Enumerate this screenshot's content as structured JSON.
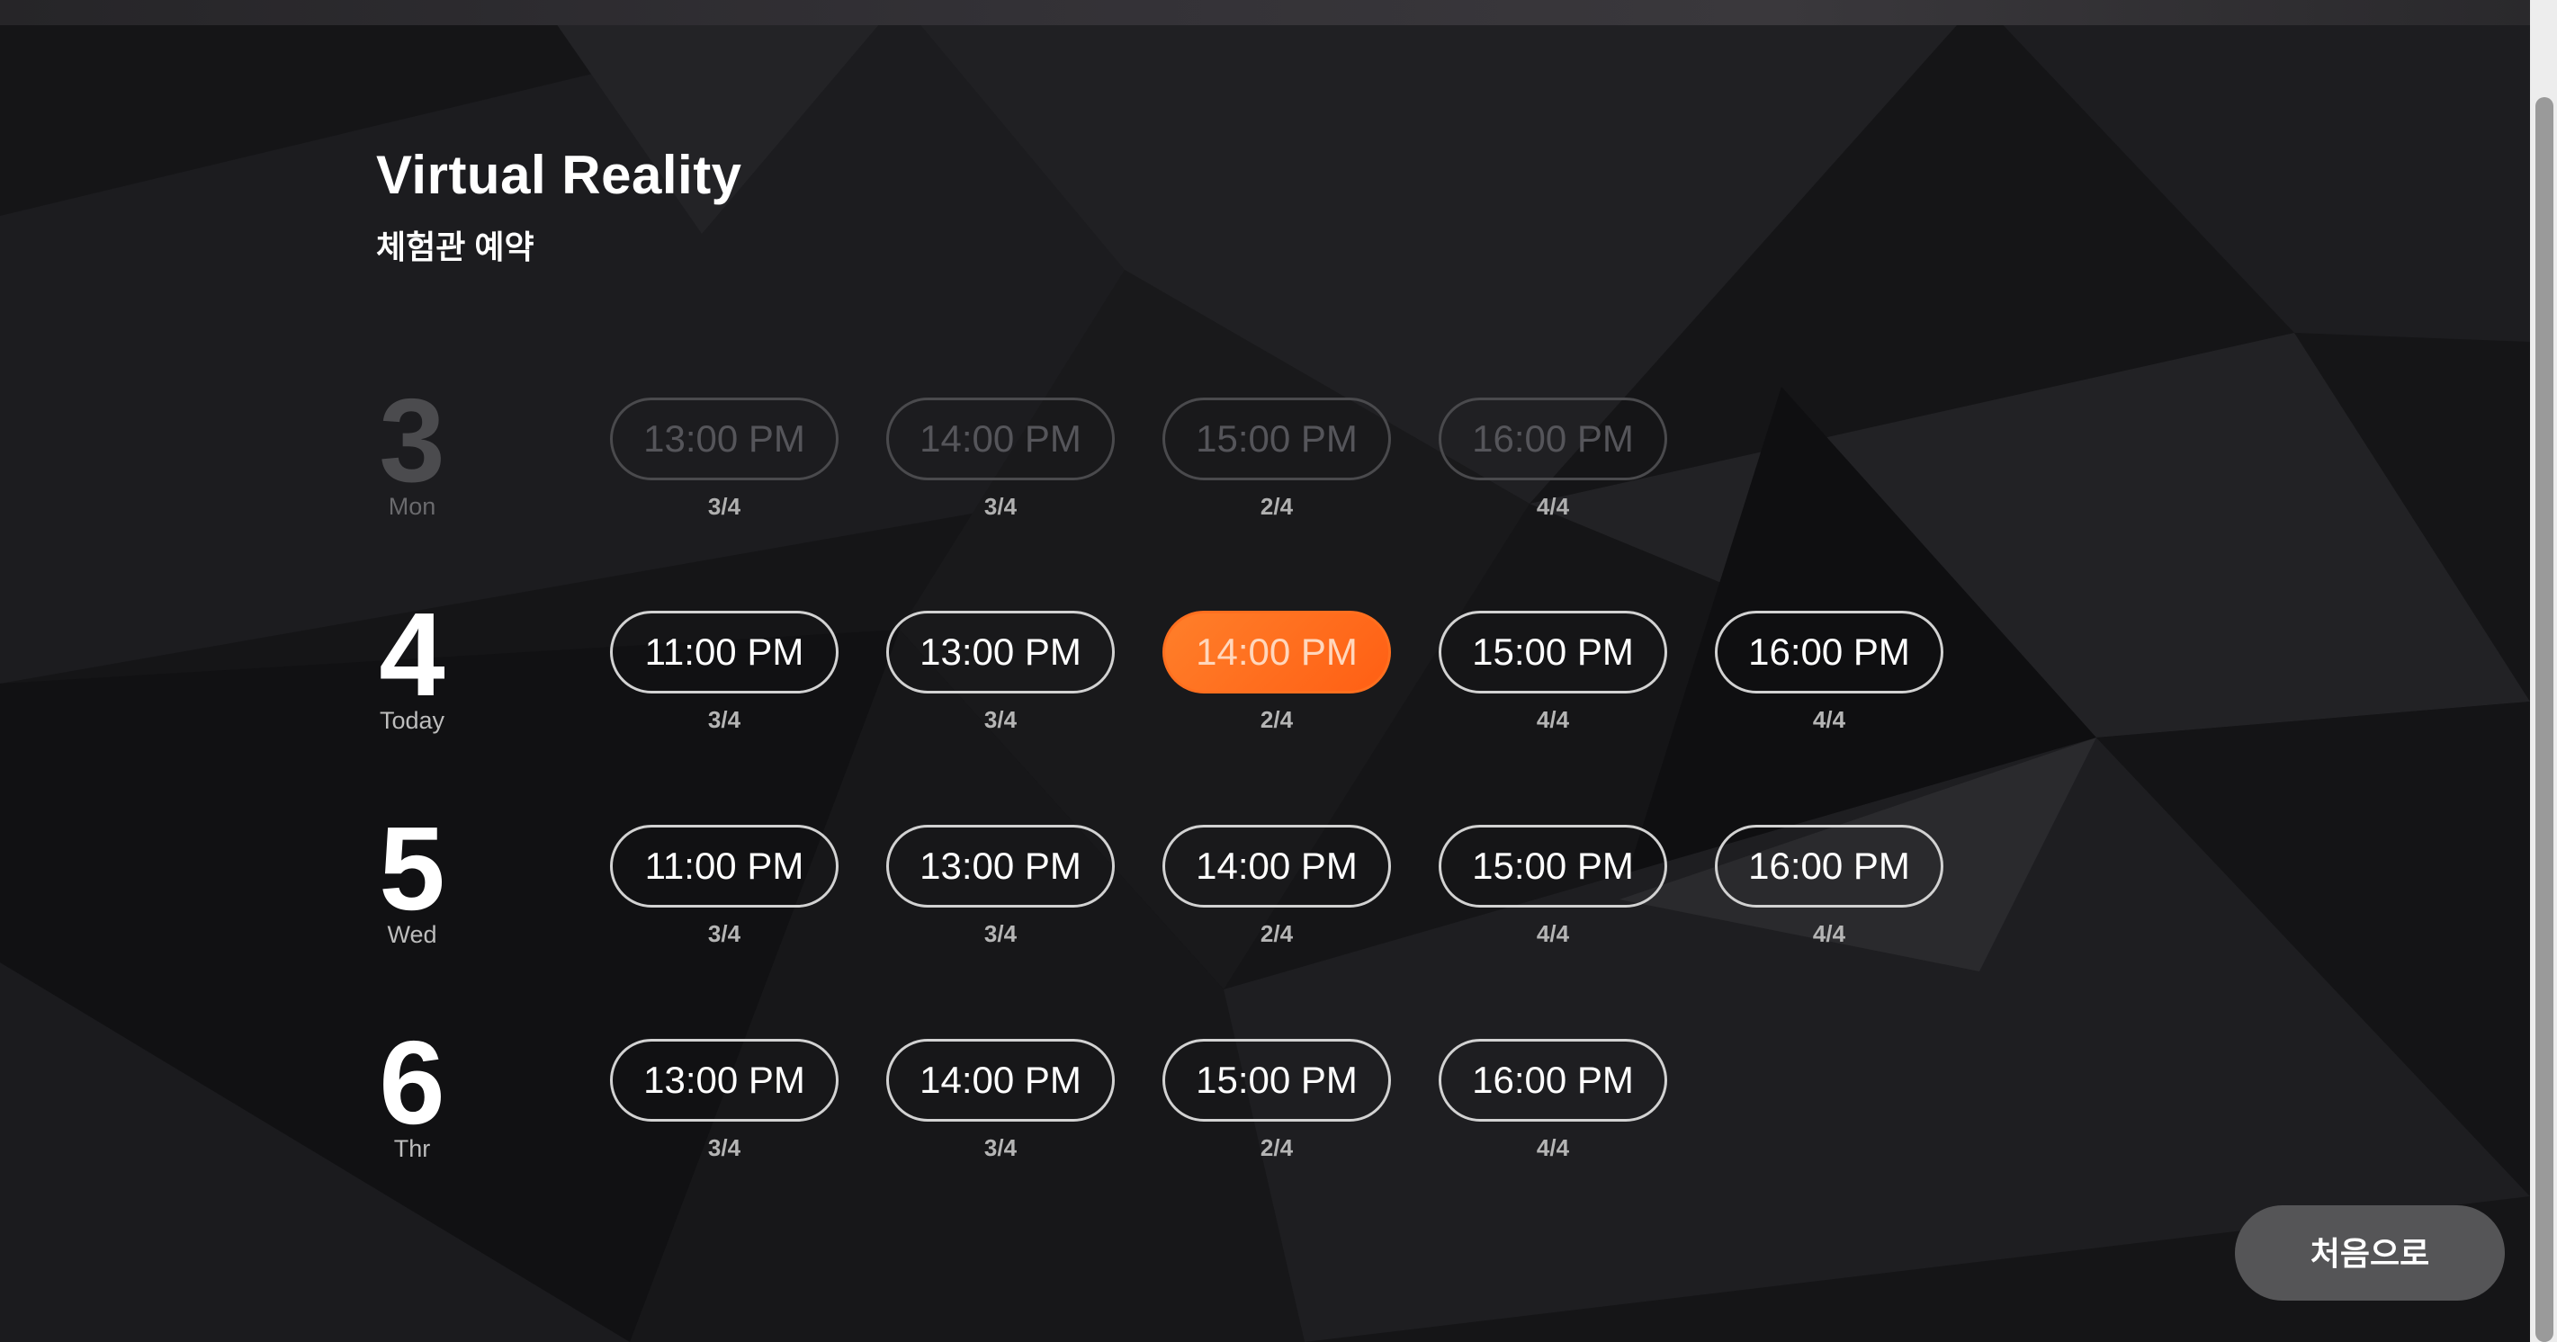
{
  "header": {
    "title": "Virtual Reality",
    "subtitle": "체험관 예약"
  },
  "schedule": [
    {
      "date": "3",
      "day": "Mon",
      "disabled": true,
      "slots": [
        {
          "time": "13:00 PM",
          "capacity": "3/4"
        },
        {
          "time": "14:00 PM",
          "capacity": "3/4"
        },
        {
          "time": "15:00 PM",
          "capacity": "2/4"
        },
        {
          "time": "16:00 PM",
          "capacity": "4/4"
        }
      ]
    },
    {
      "date": "4",
      "day": "Today",
      "disabled": false,
      "slots": [
        {
          "time": "11:00 PM",
          "capacity": "3/4"
        },
        {
          "time": "13:00 PM",
          "capacity": "3/4"
        },
        {
          "time": "14:00 PM",
          "capacity": "2/4",
          "selected": true
        },
        {
          "time": "15:00 PM",
          "capacity": "4/4"
        },
        {
          "time": "16:00 PM",
          "capacity": "4/4"
        }
      ]
    },
    {
      "date": "5",
      "day": "Wed",
      "disabled": false,
      "slots": [
        {
          "time": "11:00 PM",
          "capacity": "3/4"
        },
        {
          "time": "13:00 PM",
          "capacity": "3/4"
        },
        {
          "time": "14:00 PM",
          "capacity": "2/4"
        },
        {
          "time": "15:00 PM",
          "capacity": "4/4"
        },
        {
          "time": "16:00 PM",
          "capacity": "4/4"
        }
      ]
    },
    {
      "date": "6",
      "day": "Thr",
      "disabled": false,
      "slots": [
        {
          "time": "13:00 PM",
          "capacity": "3/4"
        },
        {
          "time": "14:00 PM",
          "capacity": "3/4"
        },
        {
          "time": "15:00 PM",
          "capacity": "2/4"
        },
        {
          "time": "16:00 PM",
          "capacity": "4/4"
        }
      ]
    }
  ],
  "home_button": {
    "label": "처음으로"
  },
  "colors": {
    "accent": "#ff6a1a",
    "background": "#151517",
    "button_gray": "#555557"
  }
}
